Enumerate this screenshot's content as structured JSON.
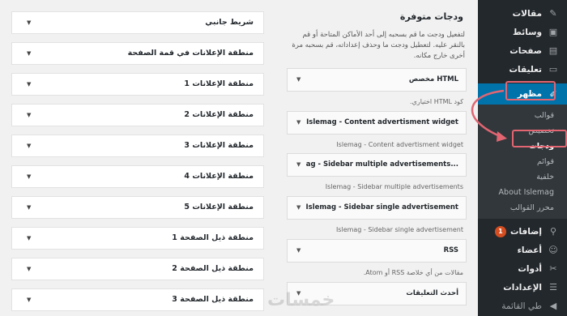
{
  "sidebar": {
    "menu": [
      {
        "label": "مقالات",
        "icon": "pin-icon"
      },
      {
        "label": "وسائط",
        "icon": "media-icon"
      },
      {
        "label": "صفحات",
        "icon": "pages-icon"
      },
      {
        "label": "تعليقات",
        "icon": "comments-icon"
      }
    ],
    "active_label": "مظهر",
    "submenu": [
      "قوالب",
      "تخصيص",
      "ودجات",
      "قوائم",
      "خلفية",
      "About Islemag",
      "محرر القوالب"
    ],
    "current_sub": "ودجات",
    "menu_bottom": [
      {
        "label": "إضافات",
        "icon": "plugins-icon",
        "badge": "1"
      },
      {
        "label": "أعضاء",
        "icon": "users-icon"
      },
      {
        "label": "أدوات",
        "icon": "tools-icon"
      },
      {
        "label": "الإعدادات",
        "icon": "settings-icon"
      },
      {
        "label": "طي القائمة",
        "icon": "collapse-icon"
      }
    ]
  },
  "available": {
    "title": "ودجات متوفرة",
    "description": "لتفعيل ودجت ما قم بسحبه إلى أحد الأماكن المتاحة أو قم بالنقر عليه. لتعطيل ودجت ما وحذف إعداداته، قم بسحبه مرة أخرى خارج مكانه.",
    "widgets": [
      {
        "title": "HTML مخصص",
        "desc": "كود HTML اختياري."
      },
      {
        "title": "Islemag - Content advertisment widget",
        "desc": "Islemag - Content advertisment widget"
      },
      {
        "title": "...ag - Sidebar multiple advertisements",
        "desc": "Islemag - Sidebar multiple advertisements"
      },
      {
        "title": "Islemag - Sidebar single advertisement",
        "desc": "Islemag - Sidebar single advertisement"
      },
      {
        "title": "RSS",
        "desc": "مقالات من أي خلاصة RSS أو Atom."
      },
      {
        "title": "أحدث التعليقات",
        "desc": ""
      }
    ]
  },
  "areas": [
    "شريط جانبي",
    "منطقة الإعلانات في قمة الصفحة",
    "منطقة الإعلانات 1",
    "منطقة الإعلانات 2",
    "منطقة الإعلانات 3",
    "منطقة الإعلانات 4",
    "منطقة الإعلانات 5",
    "منطقة ذيل الصفحة 1",
    "منطقة ذيل الصفحة 2",
    "منطقة ذيل الصفحة 3"
  ],
  "watermark": "خمسات",
  "colors": {
    "admin_bg": "#23282d",
    "active": "#0073aa",
    "highlight": "#e26571"
  }
}
